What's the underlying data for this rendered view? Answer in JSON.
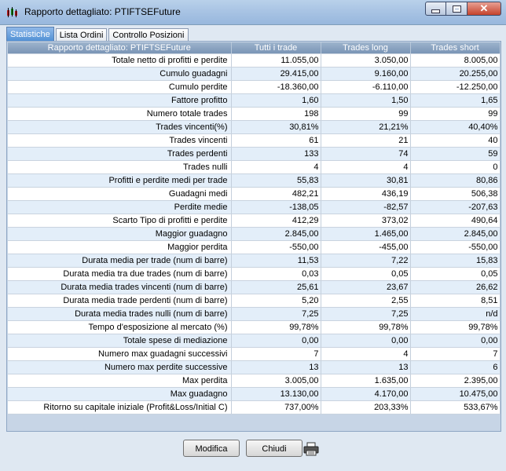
{
  "window": {
    "title": "Rapporto dettagliato: PTIFTSEFuture"
  },
  "tabs": [
    "Statistiche",
    "Lista Ordini",
    "Controllo Posizioni"
  ],
  "table": {
    "headers": [
      "Rapporto dettagliato: PTIFTSEFuture",
      "Tutti i trade",
      "Trades long",
      "Trades short"
    ],
    "rows": [
      [
        "Totale netto di profitti e perdite",
        "11.055,00",
        "3.050,00",
        "8.005,00"
      ],
      [
        "Cumulo guadagni",
        "29.415,00",
        "9.160,00",
        "20.255,00"
      ],
      [
        "Cumulo perdite",
        "-18.360,00",
        "-6.110,00",
        "-12.250,00"
      ],
      [
        "Fattore profitto",
        "1,60",
        "1,50",
        "1,65"
      ],
      [
        "Numero totale trades",
        "198",
        "99",
        "99"
      ],
      [
        "Trades vincenti(%)",
        "30,81%",
        "21,21%",
        "40,40%"
      ],
      [
        "Trades vincenti",
        "61",
        "21",
        "40"
      ],
      [
        "Trades perdenti",
        "133",
        "74",
        "59"
      ],
      [
        "Trades nulli",
        "4",
        "4",
        "0"
      ],
      [
        "Profitti e perdite medi per trade",
        "55,83",
        "30,81",
        "80,86"
      ],
      [
        "Guadagni medi",
        "482,21",
        "436,19",
        "506,38"
      ],
      [
        "Perdite medie",
        "-138,05",
        "-82,57",
        "-207,63"
      ],
      [
        "Scarto Tipo di profitti e perdite",
        "412,29",
        "373,02",
        "490,64"
      ],
      [
        "Maggior guadagno",
        "2.845,00",
        "1.465,00",
        "2.845,00"
      ],
      [
        "Maggior perdita",
        "-550,00",
        "-455,00",
        "-550,00"
      ],
      [
        "Durata media per trade (num di barre)",
        "11,53",
        "7,22",
        "15,83"
      ],
      [
        "Durata media tra due trades (num di barre)",
        "0,03",
        "0,05",
        "0,05"
      ],
      [
        "Durata media trades vincenti (num di barre)",
        "25,61",
        "23,67",
        "26,62"
      ],
      [
        "Durata media trade perdenti (num di barre)",
        "5,20",
        "2,55",
        "8,51"
      ],
      [
        "Durata media trades nulli (num di barre)",
        "7,25",
        "7,25",
        "n/d"
      ],
      [
        "Tempo d'esposizione al mercato (%)",
        "99,78%",
        "99,78%",
        "99,78%"
      ],
      [
        "Totale spese di mediazione",
        "0,00",
        "0,00",
        "0,00"
      ],
      [
        "Numero max guadagni successivi",
        "7",
        "4",
        "7"
      ],
      [
        "Numero max perdite successive",
        "13",
        "13",
        "6"
      ],
      [
        "Max perdita",
        "3.005,00",
        "1.635,00",
        "2.395,00"
      ],
      [
        "Max guadagno",
        "13.130,00",
        "4.170,00",
        "10.475,00"
      ],
      [
        "Ritorno su capitale iniziale (Profit&Loss/Initial C)",
        "737,00%",
        "203,33%",
        "533,67%"
      ]
    ]
  },
  "buttons": {
    "modify": "Modifica",
    "close": "Chiudi"
  },
  "icons": {
    "app": "chart-candles-icon",
    "print": "printer-icon"
  }
}
